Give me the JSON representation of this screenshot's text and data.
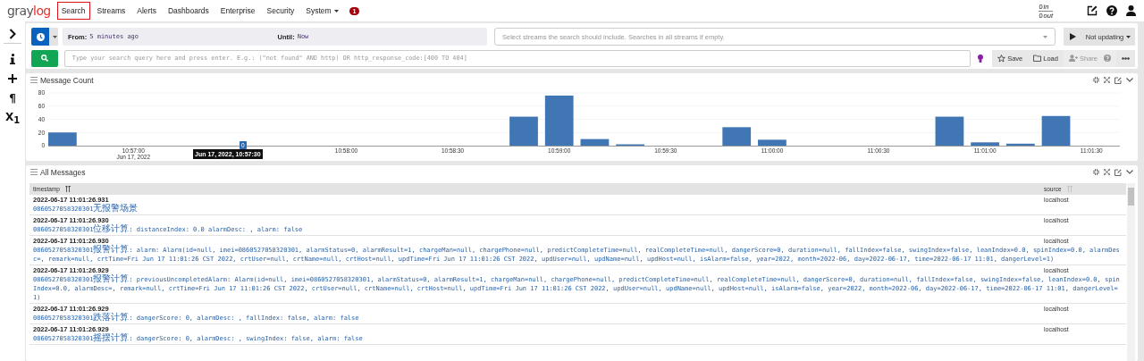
{
  "nav": {
    "logo": {
      "text": "gray",
      "accent": "log"
    },
    "items": [
      {
        "label": "Search",
        "selected": true,
        "dropdown": false
      },
      {
        "label": "Streams",
        "selected": false,
        "dropdown": false
      },
      {
        "label": "Alerts",
        "selected": false,
        "dropdown": false
      },
      {
        "label": "Dashboards",
        "selected": false,
        "dropdown": false
      },
      {
        "label": "Enterprise",
        "selected": false,
        "dropdown": false
      },
      {
        "label": "Security",
        "selected": false,
        "dropdown": false
      },
      {
        "label": "System",
        "selected": false,
        "dropdown": true
      }
    ],
    "notification_badge": "1",
    "throughput": [
      {
        "value": "0",
        "unit": "in"
      },
      {
        "value": "0",
        "unit": "out"
      }
    ]
  },
  "sidebar": {
    "items": [
      {
        "kind": "chevron"
      },
      {
        "kind": "info"
      },
      {
        "kind": "plus"
      },
      {
        "kind": "glyph",
        "text": "¶"
      },
      {
        "kind": "glyph",
        "text": "X$_{1}$"
      }
    ]
  },
  "search_bar": {
    "time_range": {
      "from_label": "From:",
      "from": "5 minutes ago",
      "until_label": "Until:",
      "until": "Now"
    },
    "streams": {
      "placeholder": "Select streams the search should include. Searches in all streams if empty."
    },
    "refresh": {
      "label": "Not updating"
    },
    "query": {
      "placeholder": "Type your search query here and press enter. E.g.: (\"not found\" AND http) OR http_response_code:[400 TO 404]"
    },
    "actions": [
      {
        "kind": "save",
        "label": "Save",
        "disabled": false
      },
      {
        "kind": "load",
        "label": "Load",
        "disabled": false
      },
      {
        "kind": "share",
        "label": "Share",
        "disabled": true
      },
      {
        "kind": "more",
        "disabled": false
      }
    ]
  },
  "message_count": {
    "title": "Message Count",
    "chart_data": {
      "type": "bar",
      "x": [
        39400,
        39530,
        39540,
        39550,
        39560,
        39590,
        39600,
        39650,
        39660,
        39670,
        39680
      ],
      "values": [
        20,
        44,
        76,
        10,
        2,
        28,
        9,
        44,
        5,
        3,
        45
      ],
      "xlim": [
        39396,
        39698
      ],
      "ylim": [
        0,
        80
      ],
      "yticks": [
        0,
        20,
        40,
        60,
        80
      ],
      "grid": true,
      "xticks": [
        {
          "value": 39420,
          "label": "10:57:00"
        },
        {
          "value": 39480,
          "label": "10:58:00"
        },
        {
          "value": 39510,
          "label": "10:58:30"
        },
        {
          "value": 39540,
          "label": "10:59:00"
        },
        {
          "value": 39570,
          "label": "10:59:30"
        },
        {
          "value": 39600,
          "label": "11:00:00"
        },
        {
          "value": 39630,
          "label": "11:00:30"
        },
        {
          "value": 39660,
          "label": "11:01:00"
        },
        {
          "value": 39690,
          "label": "11:01:30"
        }
      ],
      "annotations": [
        "Jun 17, 2022"
      ]
    },
    "tooltip": {
      "text": "Jun 17, 2022, 10:57:30",
      "value": "0"
    }
  },
  "all_messages": {
    "title": "All Messages",
    "columns": [
      {
        "label": "timestamp",
        "sorted": true
      },
      {
        "label": "source",
        "sorted": false
      }
    ],
    "rows": [
      {
        "timestamp": "2022-06-17 11:01:26.931",
        "message": "0860527058320301无报警场景",
        "source": "localhost"
      },
      {
        "timestamp": "2022-06-17 11:01:26.930",
        "message": "0860527058320301位移计算: distanceIndex: 0.0 alarmDesc: , alarm: false",
        "source": "localhost"
      },
      {
        "timestamp": "2022-06-17 11:01:26.930",
        "message": "0860527058320301报警计算: alarm: Alarm(id=null, imei=0860527058320301, alarmStatus=0, alarmResult=1, chargeMan=null, chargePhone=null, predictCompleteTime=null, realCompleteTime=null, dangerScore=0, duration=null, fallIndex=false, swingIndex=false, leanIndex=0.0, spinIndex=0.0, alarmDesc=, remark=null, crtTime=Fri Jun 17 11:01:26 CST 2022, crtUser=null, crtName=null, crtHost=null, updTime=Fri Jun 17 11:01:26 CST 2022, updUser=null, updName=null, updHost=null, isAlarm=false, year=2022, month=2022-06, day=2022-06-17, time=2022-06-17 11:01, dangerLevel=1)",
        "source": "localhost"
      },
      {
        "timestamp": "2022-06-17 11:01:26.929",
        "message": "0860527058320301报警计算: previousUncompletedAlarm: Alarm(id=null, imei=0860527058320301, alarmStatus=0, alarmResult=1, chargeMan=null, chargePhone=null, predictCompleteTime=null, realCompleteTime=null, dangerScore=0, duration=null, fallIndex=false, swingIndex=false, leanIndex=0.0, spinIndex=0.0, alarmDesc=, remark=null, crtTime=Fri Jun 17 11:01:26 CST 2022, crtUser=null, crtName=null, crtHost=null, updTime=Fri Jun 17 11:01:26 CST 2022, updUser=null, updName=null, updHost=null, isAlarm=false, year=2022, month=2022-06, day=2022-06-17, time=2022-06-17 11:01, dangerLevel=1)",
        "source": "localhost"
      },
      {
        "timestamp": "2022-06-17 11:01:26.929",
        "message": "0860527058320301跌落计算: dangerScore: 0, alarmDesc: , fallIndex: false, alarm: false",
        "source": "localhost"
      },
      {
        "timestamp": "2022-06-17 11:01:26.929",
        "message": "0860527058320301摇摆计算: dangerScore: 0, alarmDesc: , swingIndex: false, alarm: false",
        "source": "localhost"
      }
    ]
  }
}
